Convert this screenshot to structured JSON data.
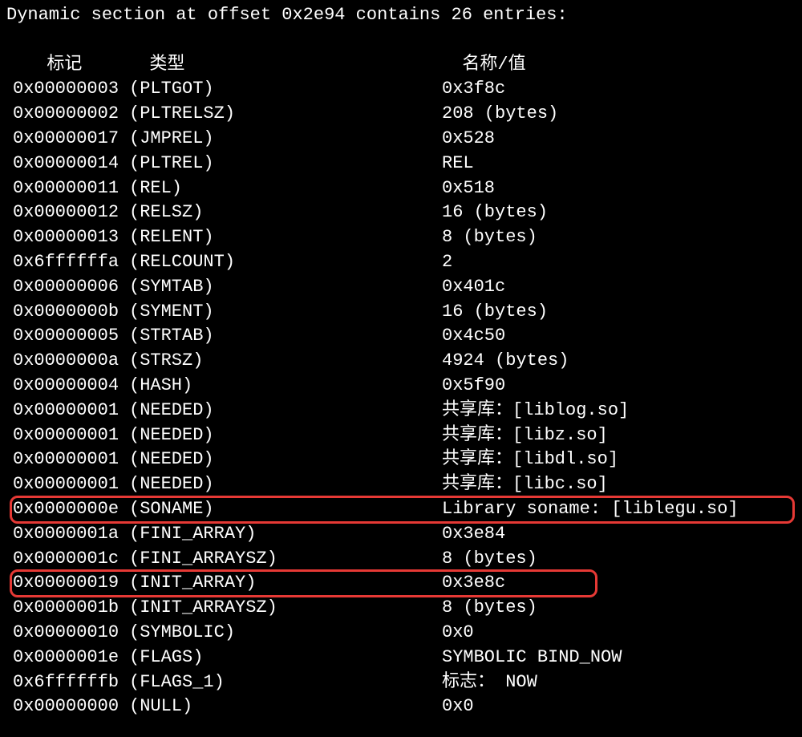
{
  "title": "Dynamic section at offset 0x2e94 contains 26 entries:",
  "headers": {
    "tag": "标记",
    "type": "类型",
    "value": "名称/值"
  },
  "entries": [
    {
      "tag": "0x00000003",
      "type": "(PLTGOT)",
      "value": "0x3f8c",
      "highlight": null
    },
    {
      "tag": "0x00000002",
      "type": "(PLTRELSZ)",
      "value": "208 (bytes)",
      "highlight": null
    },
    {
      "tag": "0x00000017",
      "type": "(JMPREL)",
      "value": "0x528",
      "highlight": null
    },
    {
      "tag": "0x00000014",
      "type": "(PLTREL)",
      "value": "REL",
      "highlight": null
    },
    {
      "tag": "0x00000011",
      "type": "(REL)",
      "value": "0x518",
      "highlight": null
    },
    {
      "tag": "0x00000012",
      "type": "(RELSZ)",
      "value": "16 (bytes)",
      "highlight": null
    },
    {
      "tag": "0x00000013",
      "type": "(RELENT)",
      "value": "8 (bytes)",
      "highlight": null
    },
    {
      "tag": "0x6ffffffa",
      "type": "(RELCOUNT)",
      "value": "2",
      "highlight": null
    },
    {
      "tag": "0x00000006",
      "type": "(SYMTAB)",
      "value": "0x401c",
      "highlight": null
    },
    {
      "tag": "0x0000000b",
      "type": "(SYMENT)",
      "value": "16 (bytes)",
      "highlight": null
    },
    {
      "tag": "0x00000005",
      "type": "(STRTAB)",
      "value": "0x4c50",
      "highlight": null
    },
    {
      "tag": "0x0000000a",
      "type": "(STRSZ)",
      "value": "4924 (bytes)",
      "highlight": null
    },
    {
      "tag": "0x00000004",
      "type": "(HASH)",
      "value": "0x5f90",
      "highlight": null
    },
    {
      "tag": "0x00000001",
      "type": "(NEEDED)",
      "value": "共享库：[liblog.so]",
      "highlight": null
    },
    {
      "tag": "0x00000001",
      "type": "(NEEDED)",
      "value": "共享库：[libz.so]",
      "highlight": null
    },
    {
      "tag": "0x00000001",
      "type": "(NEEDED)",
      "value": "共享库：[libdl.so]",
      "highlight": null
    },
    {
      "tag": "0x00000001",
      "type": "(NEEDED)",
      "value": "共享库：[libc.so]",
      "highlight": null
    },
    {
      "tag": "0x0000000e",
      "type": "(SONAME)",
      "value": "Library soname: [liblegu.so]",
      "highlight": "1"
    },
    {
      "tag": "0x0000001a",
      "type": "(FINI_ARRAY)",
      "value": "0x3e84",
      "highlight": null
    },
    {
      "tag": "0x0000001c",
      "type": "(FINI_ARRAYSZ)",
      "value": "8 (bytes)",
      "highlight": null
    },
    {
      "tag": "0x00000019",
      "type": "(INIT_ARRAY)",
      "value": "0x3e8c",
      "highlight": "2"
    },
    {
      "tag": "0x0000001b",
      "type": "(INIT_ARRAYSZ)",
      "value": "8 (bytes)",
      "highlight": null
    },
    {
      "tag": "0x00000010",
      "type": "(SYMBOLIC)",
      "value": "0x0",
      "highlight": null
    },
    {
      "tag": "0x0000001e",
      "type": "(FLAGS)",
      "value": "SYMBOLIC BIND_NOW",
      "highlight": null
    },
    {
      "tag": "0x6ffffffb",
      "type": "(FLAGS_1)",
      "value": "标志： NOW",
      "highlight": null
    },
    {
      "tag": "0x00000000",
      "type": "(NULL)",
      "value": "0x0",
      "highlight": null
    }
  ]
}
